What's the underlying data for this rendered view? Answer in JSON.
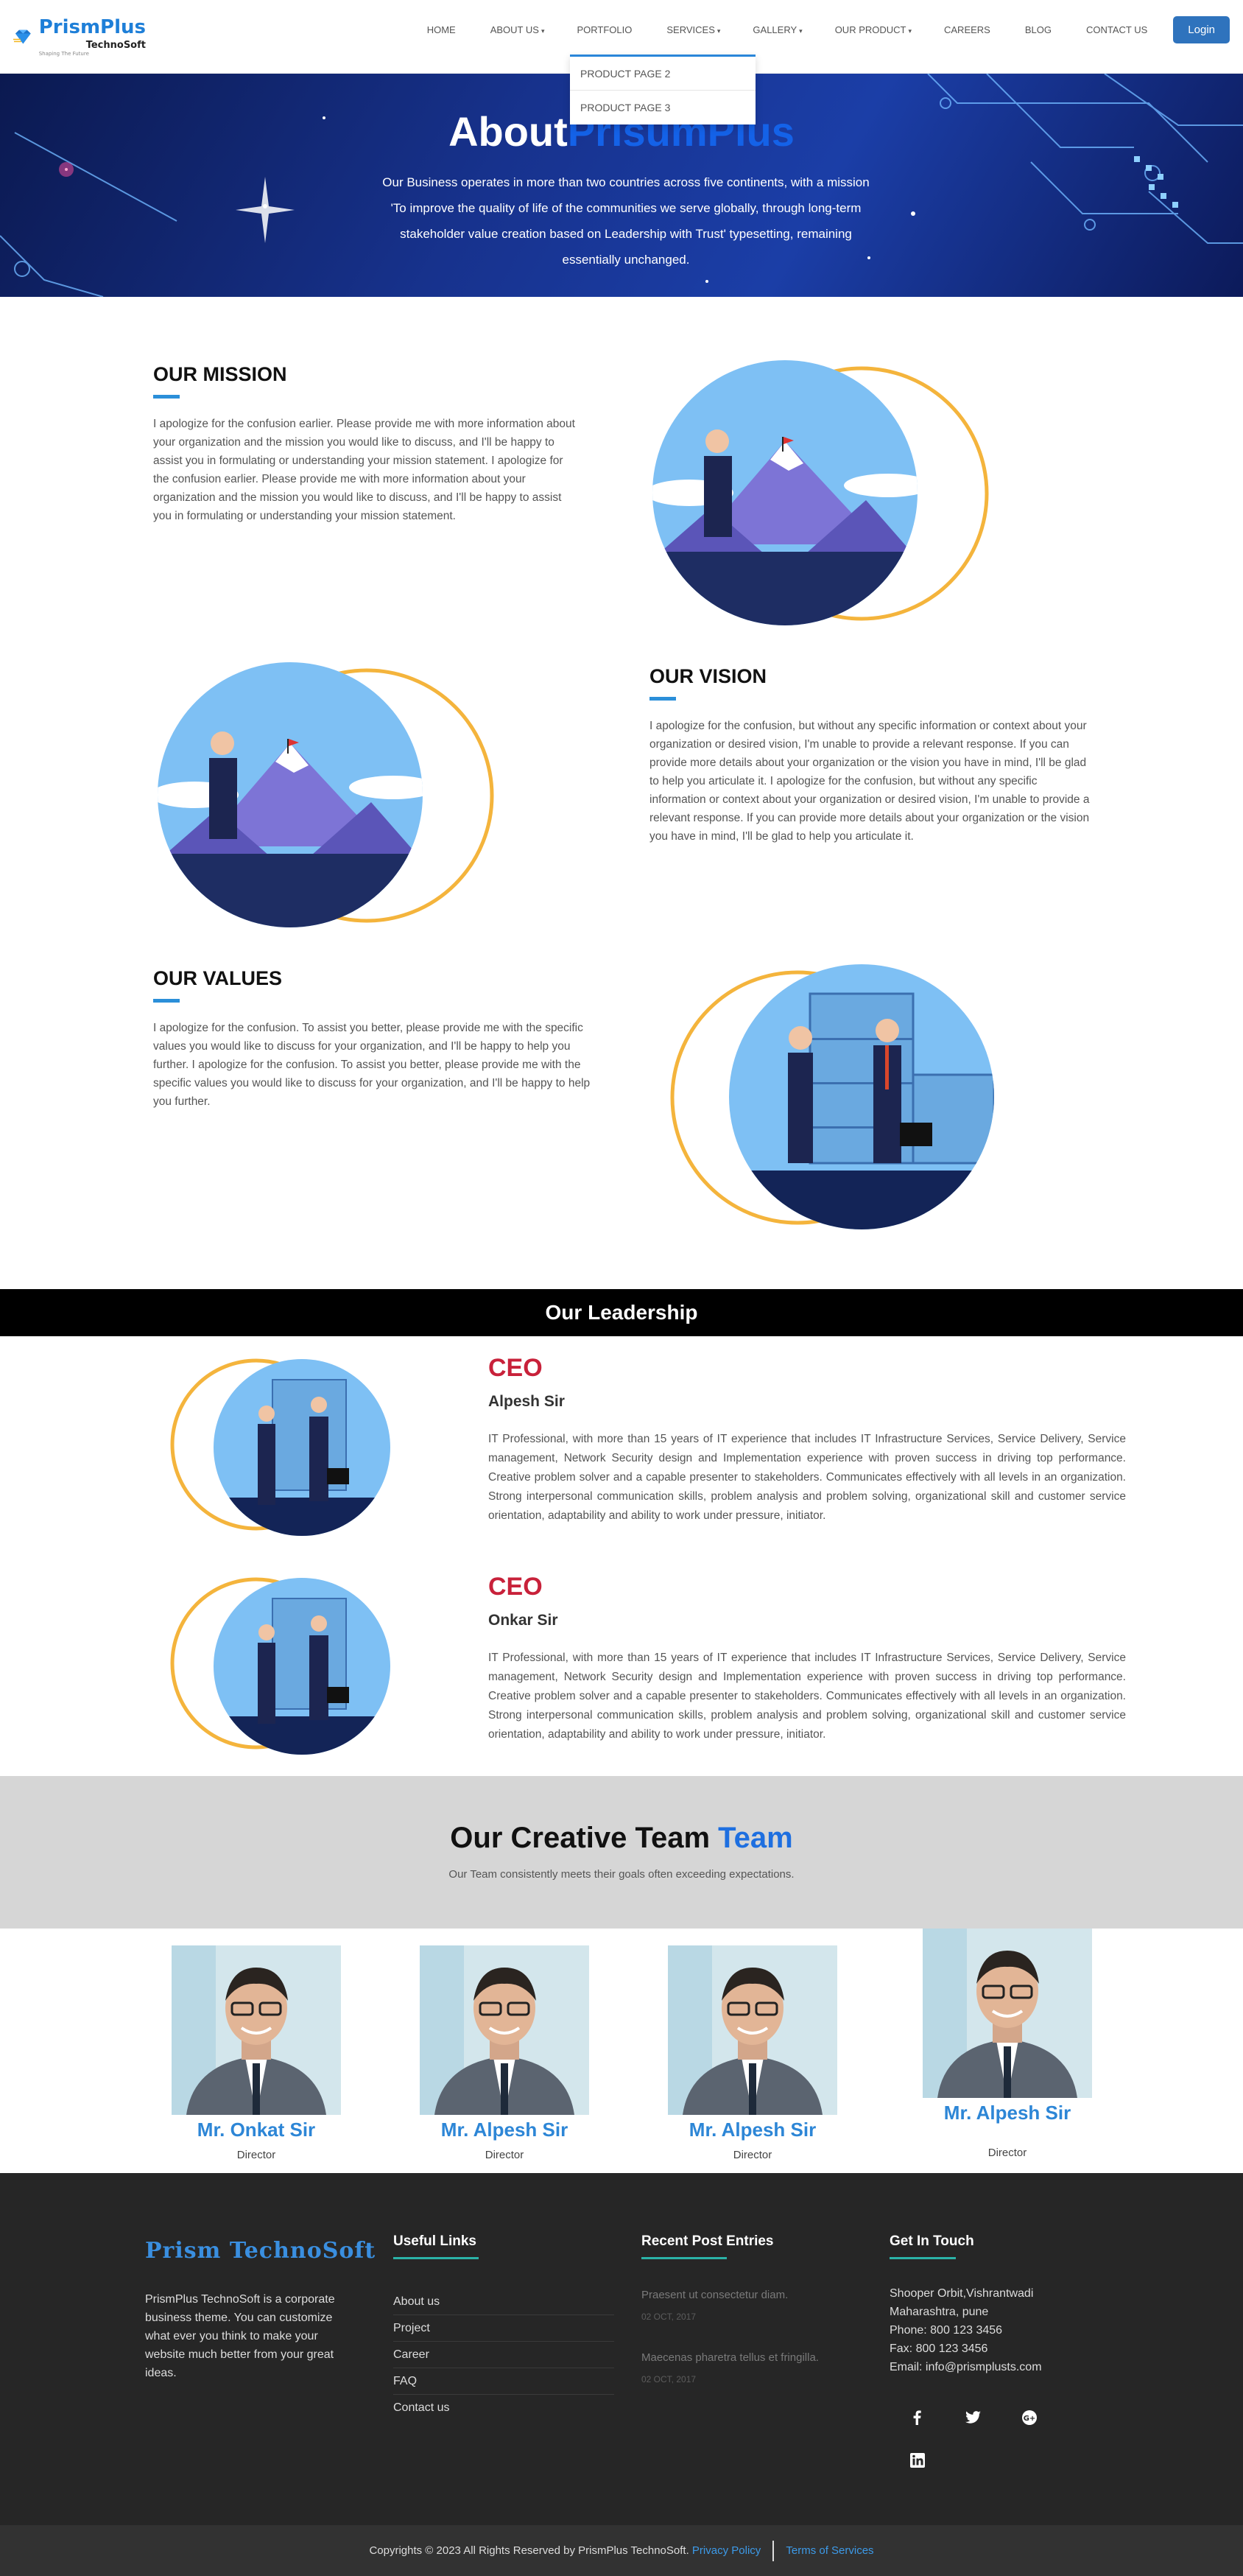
{
  "header": {
    "logo_main": "PrismPlus",
    "logo_sub": "TechnoSoft",
    "logo_tag": "Shaping The Future",
    "menu": [
      {
        "label": "HOME",
        "caret": ""
      },
      {
        "label": "ABOUT US",
        "caret": "▾"
      },
      {
        "label": "PORTFOLIO",
        "caret": ""
      },
      {
        "label": "SERVICES",
        "caret": "▾"
      },
      {
        "label": "GALLERY",
        "caret": "▾"
      },
      {
        "label": "OUR PRODUCT",
        "caret": "▾"
      },
      {
        "label": "CAREERS",
        "caret": ""
      },
      {
        "label": "BLOG",
        "caret": ""
      },
      {
        "label": "CONTACT US",
        "caret": ""
      }
    ],
    "login_label": "Login",
    "dropdown": [
      "PRODUCT PAGE 2",
      "PRODUCT PAGE 3"
    ]
  },
  "hero": {
    "title_a": "About",
    "title_b": "PrisumPlus",
    "text": "Our Business operates in more than two countries across five continents, with a mission 'To improve the quality of life of the communities we serve globally, through long-term stakeholder value creation based on Leadership with Trust' typesetting, remaining essentially unchanged."
  },
  "mission": {
    "heading": "OUR MISSION",
    "text": "I apologize for the confusion earlier. Please provide me with more information about your organization and the mission you would like to discuss, and I'll be happy to assist you in formulating or understanding your mission statement. I apologize for the confusion earlier. Please provide me with more information about your organization and the mission you would like to discuss, and I'll be happy to assist you in formulating or understanding your mission statement."
  },
  "vision": {
    "heading": "OUR VISION",
    "text": "I apologize for the confusion, but without any specific information or context about your organization or desired vision, I'm unable to provide a relevant response. If you can provide more details about your organization or the vision you have in mind, I'll be glad to help you articulate it. I apologize for the confusion, but without any specific information or context about your organization or desired vision, I'm unable to provide a relevant response. If you can provide more details about your organization or the vision you have in mind, I'll be glad to help you articulate it."
  },
  "values": {
    "heading": "OUR VALUES",
    "text": "I apologize for the confusion. To assist you better, please provide me with the specific values you would like to discuss for your organization, and I'll be happy to help you further. I apologize for the confusion. To assist you better, please provide me with the specific values you would like to discuss for your organization, and I'll be happy to help you further."
  },
  "leadership": {
    "heading": "Our Leadership",
    "leaders": [
      {
        "role": "CEO",
        "name": "Alpesh Sir",
        "bio": "IT Professional, with more than 15 years of IT experience that includes IT Infrastructure Services, Service Delivery, Service management, Network Security design and Implementation experience with proven success in driving top performance. Creative problem solver and a capable presenter to stakeholders. Communicates effectively with all levels in an organization. Strong interpersonal communication skills, problem analysis and problem solving, organizational skill and customer service orientation, adaptability and ability to work under pressure, initiator."
      },
      {
        "role": "CEO",
        "name": "Onkar Sir",
        "bio": "IT Professional, with more than 15 years of IT experience that includes IT Infrastructure Services, Service Delivery, Service management, Network Security design and Implementation experience with proven success in driving top performance. Creative problem solver and a capable presenter to stakeholders. Communicates effectively with all levels in an organization. Strong interpersonal communication skills, problem analysis and problem solving, organizational skill and customer service orientation, adaptability and ability to work under pressure, initiator."
      }
    ]
  },
  "team": {
    "title_a": "Our Creative Team",
    "title_b": "Team",
    "subtitle": "Our Team consistently meets their goals often exceeding expectations.",
    "members": [
      {
        "name": "Mr. Onkat Sir",
        "role": "Director"
      },
      {
        "name": "Mr. Alpesh Sir",
        "role": "Director"
      },
      {
        "name": "Mr. Alpesh Sir",
        "role": "Director"
      },
      {
        "name": "Mr. Alpesh Sir",
        "role": "Director"
      }
    ]
  },
  "footer": {
    "logo": "Prism TechnoSoft",
    "about": "PrismPlus TechnoSoft is a corporate business theme. You can customize what ever you think to make your website much better from your great ideas.",
    "useful_heading": "Useful Links",
    "useful_links": [
      "About us",
      "Project",
      "Career",
      "FAQ",
      "Contact us"
    ],
    "posts_heading": "Recent Post Entries",
    "posts": [
      {
        "title": "Praesent ut consectetur diam.",
        "date": "02 OCT, 2017"
      },
      {
        "title": "Maecenas pharetra tellus et fringilla.",
        "date": "02 OCT, 2017"
      }
    ],
    "contact_heading": "Get In Touch",
    "contact": [
      "Shooper Orbit,Vishrantwadi",
      "Maharashtra, pune",
      "Phone: 800 123 3456",
      "Fax: 800 123 3456",
      "Email: info@prismplusts.com"
    ],
    "copyright": "Copyrights © 2023 All Rights Reserved by PrismPlus TechnoSoft.",
    "privacy": "Privacy Policy",
    "terms": "Terms of Services"
  },
  "colors": {
    "accent_blue": "#2b8fd9",
    "ring_gold": "#f4b43c",
    "ceo_red": "#c8213a",
    "footer_bg": "#262626"
  }
}
